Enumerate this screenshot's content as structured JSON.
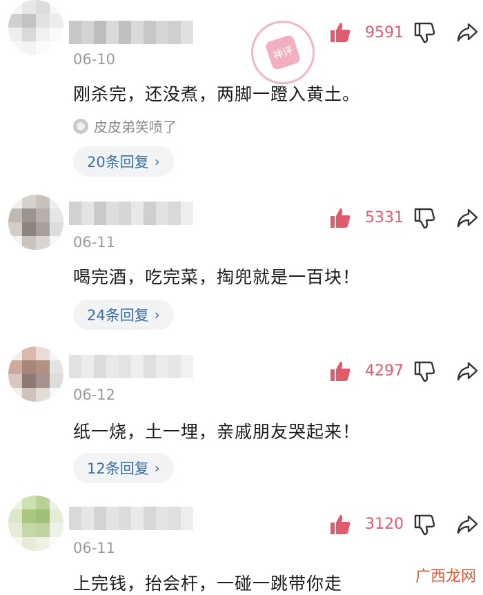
{
  "comments": [
    {
      "date": "06-10",
      "text": "刚杀完，还没煮，两脚一蹬入黄土。",
      "reaction": "皮皮弟笑喷了",
      "likes": "9591",
      "replies": "20条回复",
      "avatar_colors": [
        "#f4f4f4",
        "#e6e6e6",
        "#dcdcdc",
        "#f6f6f6",
        "#d0d0d0",
        "#c3c3c3",
        "#e2e2e2",
        "#ededed",
        "#eeeeee",
        "#d9d9d9",
        "#f1f1f1",
        "#fafafa",
        "#f8f8f8",
        "#f3f3f3",
        "#fbfbfb",
        "#ffffff"
      ],
      "name_colors": [
        "#c8c8c8",
        "#d4d4d4",
        "#bdbdbd",
        "#d9d9d9",
        "#c0c0c0",
        "#dadada",
        "#c7c7c7",
        "#d6d6d6",
        "#cfcfcf",
        "#e0e0e0"
      ]
    },
    {
      "date": "06-11",
      "text": "喝完酒，吃完菜，掏兜就是一百块！",
      "likes": "5331",
      "replies": "24条回复",
      "avatar_colors": [
        "#f2efed",
        "#d8d2cc",
        "#c9c2bb",
        "#eeeeee",
        "#bfb9b3",
        "#9c948c",
        "#b7b0a8",
        "#e6e6e6",
        "#d1ccc7",
        "#8c847d",
        "#a7a09a",
        "#dcdcdc",
        "#f4f2f0",
        "#c9c4bf",
        "#d8d5d2",
        "#f6f6f6"
      ],
      "name_colors": [
        "#d1d1d1",
        "#e4e4e4",
        "#c9c9c9",
        "#dedede",
        "#d6d6d6",
        "#e8e8e8",
        "#cfcfcf",
        "#e2e2e2",
        "#d9d9d9",
        "#eeeeee"
      ]
    },
    {
      "date": "06-12",
      "text": "纸一烧，土一埋，亲戚朋友哭起来！",
      "likes": "4297",
      "replies": "12条回复",
      "avatar_colors": [
        "#f4eeea",
        "#d9b8ad",
        "#e8ddd7",
        "#f6f6f6",
        "#cfa99c",
        "#a8877a",
        "#b48f83",
        "#e4e4e4",
        "#d8c7be",
        "#8e7a72",
        "#a6948c",
        "#dcdcdc",
        "#f3efec",
        "#d0c3bc",
        "#e2dbd6",
        "#f8f8f8"
      ],
      "name_colors": [
        "#e1e1e1",
        "#ececec",
        "#dcdcdc",
        "#e9e9e9",
        "#e3e3e3",
        "#efefef",
        "#dfdfdf",
        "#ebebeb",
        "#e6e6e6",
        "#f1f1f1"
      ]
    },
    {
      "date": "06-11",
      "text": "上完钱，抬会杆，一碰一跳带你走",
      "likes": "3120",
      "avatar_colors": [
        "#eef4e2",
        "#cfe0b2",
        "#b9d196",
        "#eef2e6",
        "#dbe7c6",
        "#a9c77f",
        "#9fc07a",
        "#e4ecd6",
        "#e6ecd8",
        "#c7d8a8",
        "#bfd3a0",
        "#eef1e6",
        "#f6f8f0",
        "#e6ecd8",
        "#eef2e4",
        "#fafafa"
      ],
      "name_colors": [
        "#d9d9d9",
        "#e6e6e6",
        "#d3d3d3",
        "#e3e3e3",
        "#dcdcdc",
        "#eaeaea",
        "#d7d7d7",
        "#e4e4e4",
        "#dfdfdf",
        "#ededed"
      ]
    }
  ],
  "watermark": "广西龙网",
  "stamp_text": "神评",
  "accent_color": "#e05b6b",
  "icons": {
    "like": "thumbs-up-icon",
    "dislike": "thumbs-down-icon",
    "share": "share-icon",
    "reaction": "laugh-emoji-icon"
  }
}
